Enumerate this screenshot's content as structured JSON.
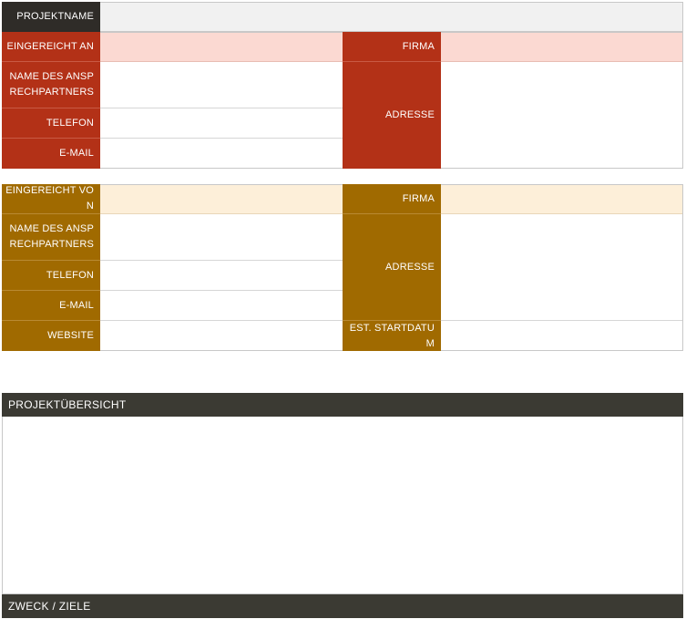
{
  "header": {
    "project_name_label": "PROJEKTNAME"
  },
  "submitted_to": {
    "submitted_label": "EINGEREICHT AN",
    "contact_label": "NAME DES ANSPRECHPARTNERS",
    "phone_label": "TELEFON",
    "email_label": "E-MAIL",
    "company_label": "FIRMA",
    "address_label": "ADRESSE"
  },
  "submitted_by": {
    "submitted_label": "EINGEREICHT VON",
    "contact_label": "NAME DES ANSPRECHPARTNERS",
    "phone_label": "TELEFON",
    "email_label": "E-MAIL",
    "website_label": "WEBSITE",
    "company_label": "FIRMA",
    "address_label": "ADRESSE",
    "start_date_label": "EST. STARTDATUM"
  },
  "overview": {
    "title": "PROJEKTÜBERSICHT"
  },
  "purpose": {
    "title": "ZWECK / ZIELE"
  },
  "colors": {
    "header_dark": "#2f2c28",
    "section1_accent": "#b33117",
    "section1_tint": "#fbd9d2",
    "section2_accent": "#a06a00",
    "section2_tint": "#fdefd9",
    "bar_dark": "#3b3a33"
  }
}
